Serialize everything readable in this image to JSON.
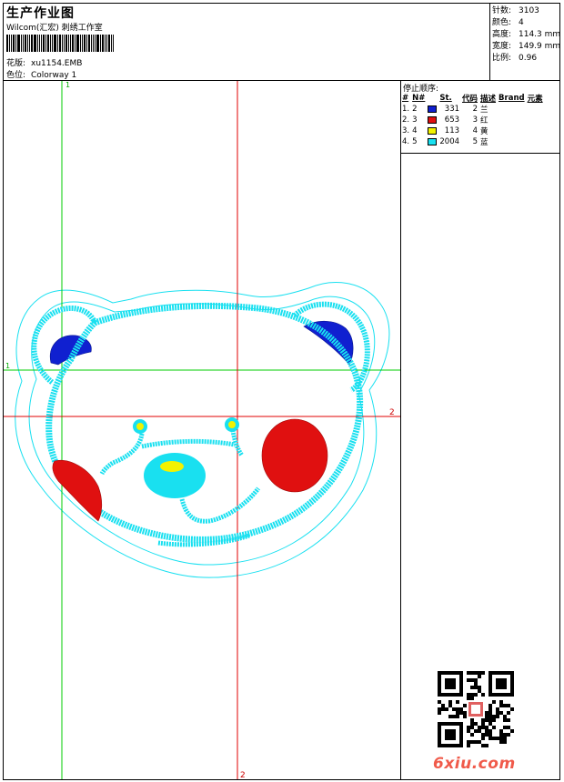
{
  "header": {
    "title": "生产作业图",
    "subtitle": "Wilcom(汇宏) 刺绣工作室",
    "design_label": "花版:",
    "design_value": "xu1154.EMB",
    "colorway_label": "色位:",
    "colorway_value": "Colorway 1"
  },
  "stats": [
    {
      "label": "针数:",
      "value": "3103"
    },
    {
      "label": "颜色:",
      "value": "4"
    },
    {
      "label": "高度:",
      "value": "114.3 mm"
    },
    {
      "label": "宽度:",
      "value": "149.9 mm"
    },
    {
      "label": "比例:",
      "value": "0.96"
    }
  ],
  "stop_sequence": {
    "title": "停止顺序:",
    "headers": [
      "#",
      "N#",
      "St.",
      "代码",
      "描述",
      "Brand",
      "元素"
    ],
    "rows": [
      {
        "index": "1.",
        "needle": "2",
        "color": "#1020d0",
        "stitches": "331",
        "code": "2",
        "desc": "兰"
      },
      {
        "index": "2.",
        "needle": "3",
        "color": "#e01010",
        "stitches": "653",
        "code": "3",
        "desc": "红"
      },
      {
        "index": "3.",
        "needle": "4",
        "color": "#f2f200",
        "stitches": "113",
        "code": "4",
        "desc": "黄"
      },
      {
        "index": "4.",
        "needle": "5",
        "color": "#19e0f0",
        "stitches": "2004",
        "code": "5",
        "desc": "蓝"
      }
    ]
  },
  "guides": {
    "v1_label": "1",
    "h1_label": "1",
    "v2_label": "2",
    "h2_label": "2"
  },
  "colors": {
    "outline": "#19e0f0",
    "blue": "#1020d0",
    "red": "#e01010",
    "yellow": "#f2f200",
    "green_guide": "#00cc00",
    "red_guide": "#e00000"
  },
  "watermark": {
    "brand": "6xiu.com"
  }
}
